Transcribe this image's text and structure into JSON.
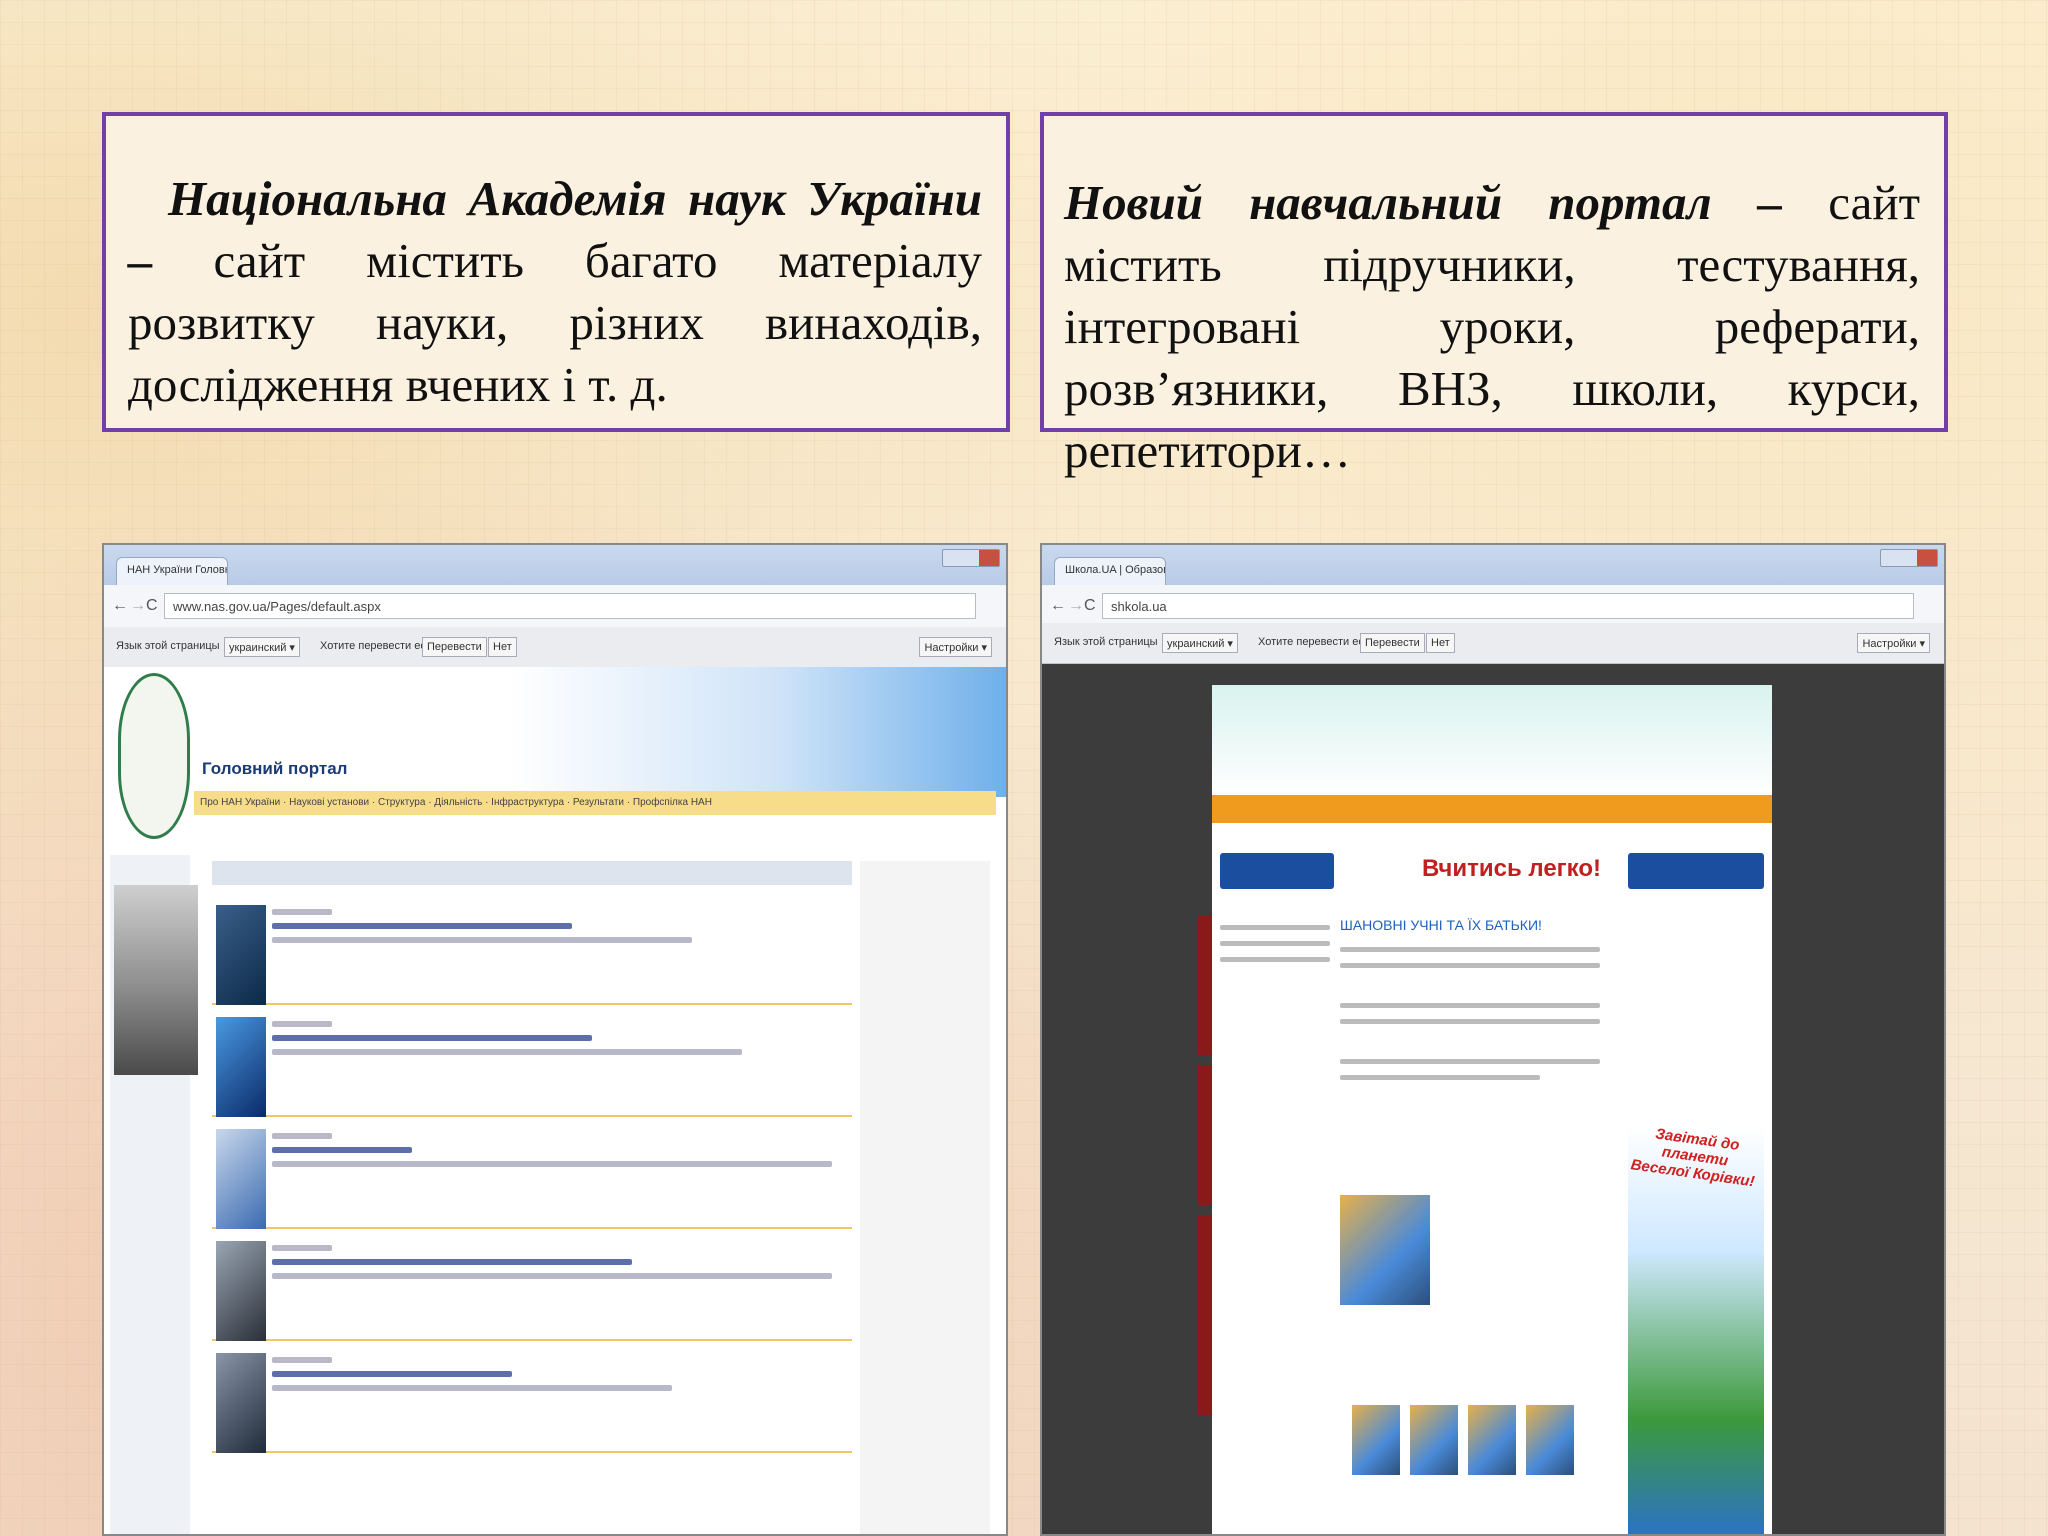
{
  "left_box": {
    "bold": "Національна Академія наук України –",
    "text": " сайт містить багато матеріалу розвитку науки, різних винаходів, дослідження вчених і т. д."
  },
  "right_box": {
    "bold": "Новий навчальний портал –",
    "text": " сайт містить підручники, тестування, інтегровані уроки, реферати, розв’язники, ВНЗ, школи, курси, репетитори…"
  },
  "left_browser": {
    "tab_title": "НАН України Головна",
    "url": "www.nas.gov.ua/Pages/default.aspx",
    "translate_text": "Язык этой страницы",
    "translate_lang": "украинский ▾",
    "translate_question": "Хотите перевести ее?",
    "translate_button": "Перевести",
    "no_button": "Нет",
    "settings_button": "Настройки ▾",
    "site_title": "Головний портал",
    "menu_items": "Про НАН України · Наукові установи · Структура · Діяльність · Інфраструктура · Результати · Профспілка НАН"
  },
  "right_browser": {
    "tab_title": "Школа.UA | Образован...",
    "url": "shkola.ua",
    "translate_text": "Язык этой страницы",
    "translate_lang": "украинский ▾",
    "translate_question": "Хотите перевести ее?",
    "translate_button": "Перевести",
    "no_button": "Нет",
    "settings_button": "Настройки ▾",
    "heading": "Вчитись легко!",
    "subheading": "ШАНОВНІ УЧНІ ТА ЇХ БАТЬКИ!",
    "promo": "Завітай до планети Веселої Корівки!"
  }
}
